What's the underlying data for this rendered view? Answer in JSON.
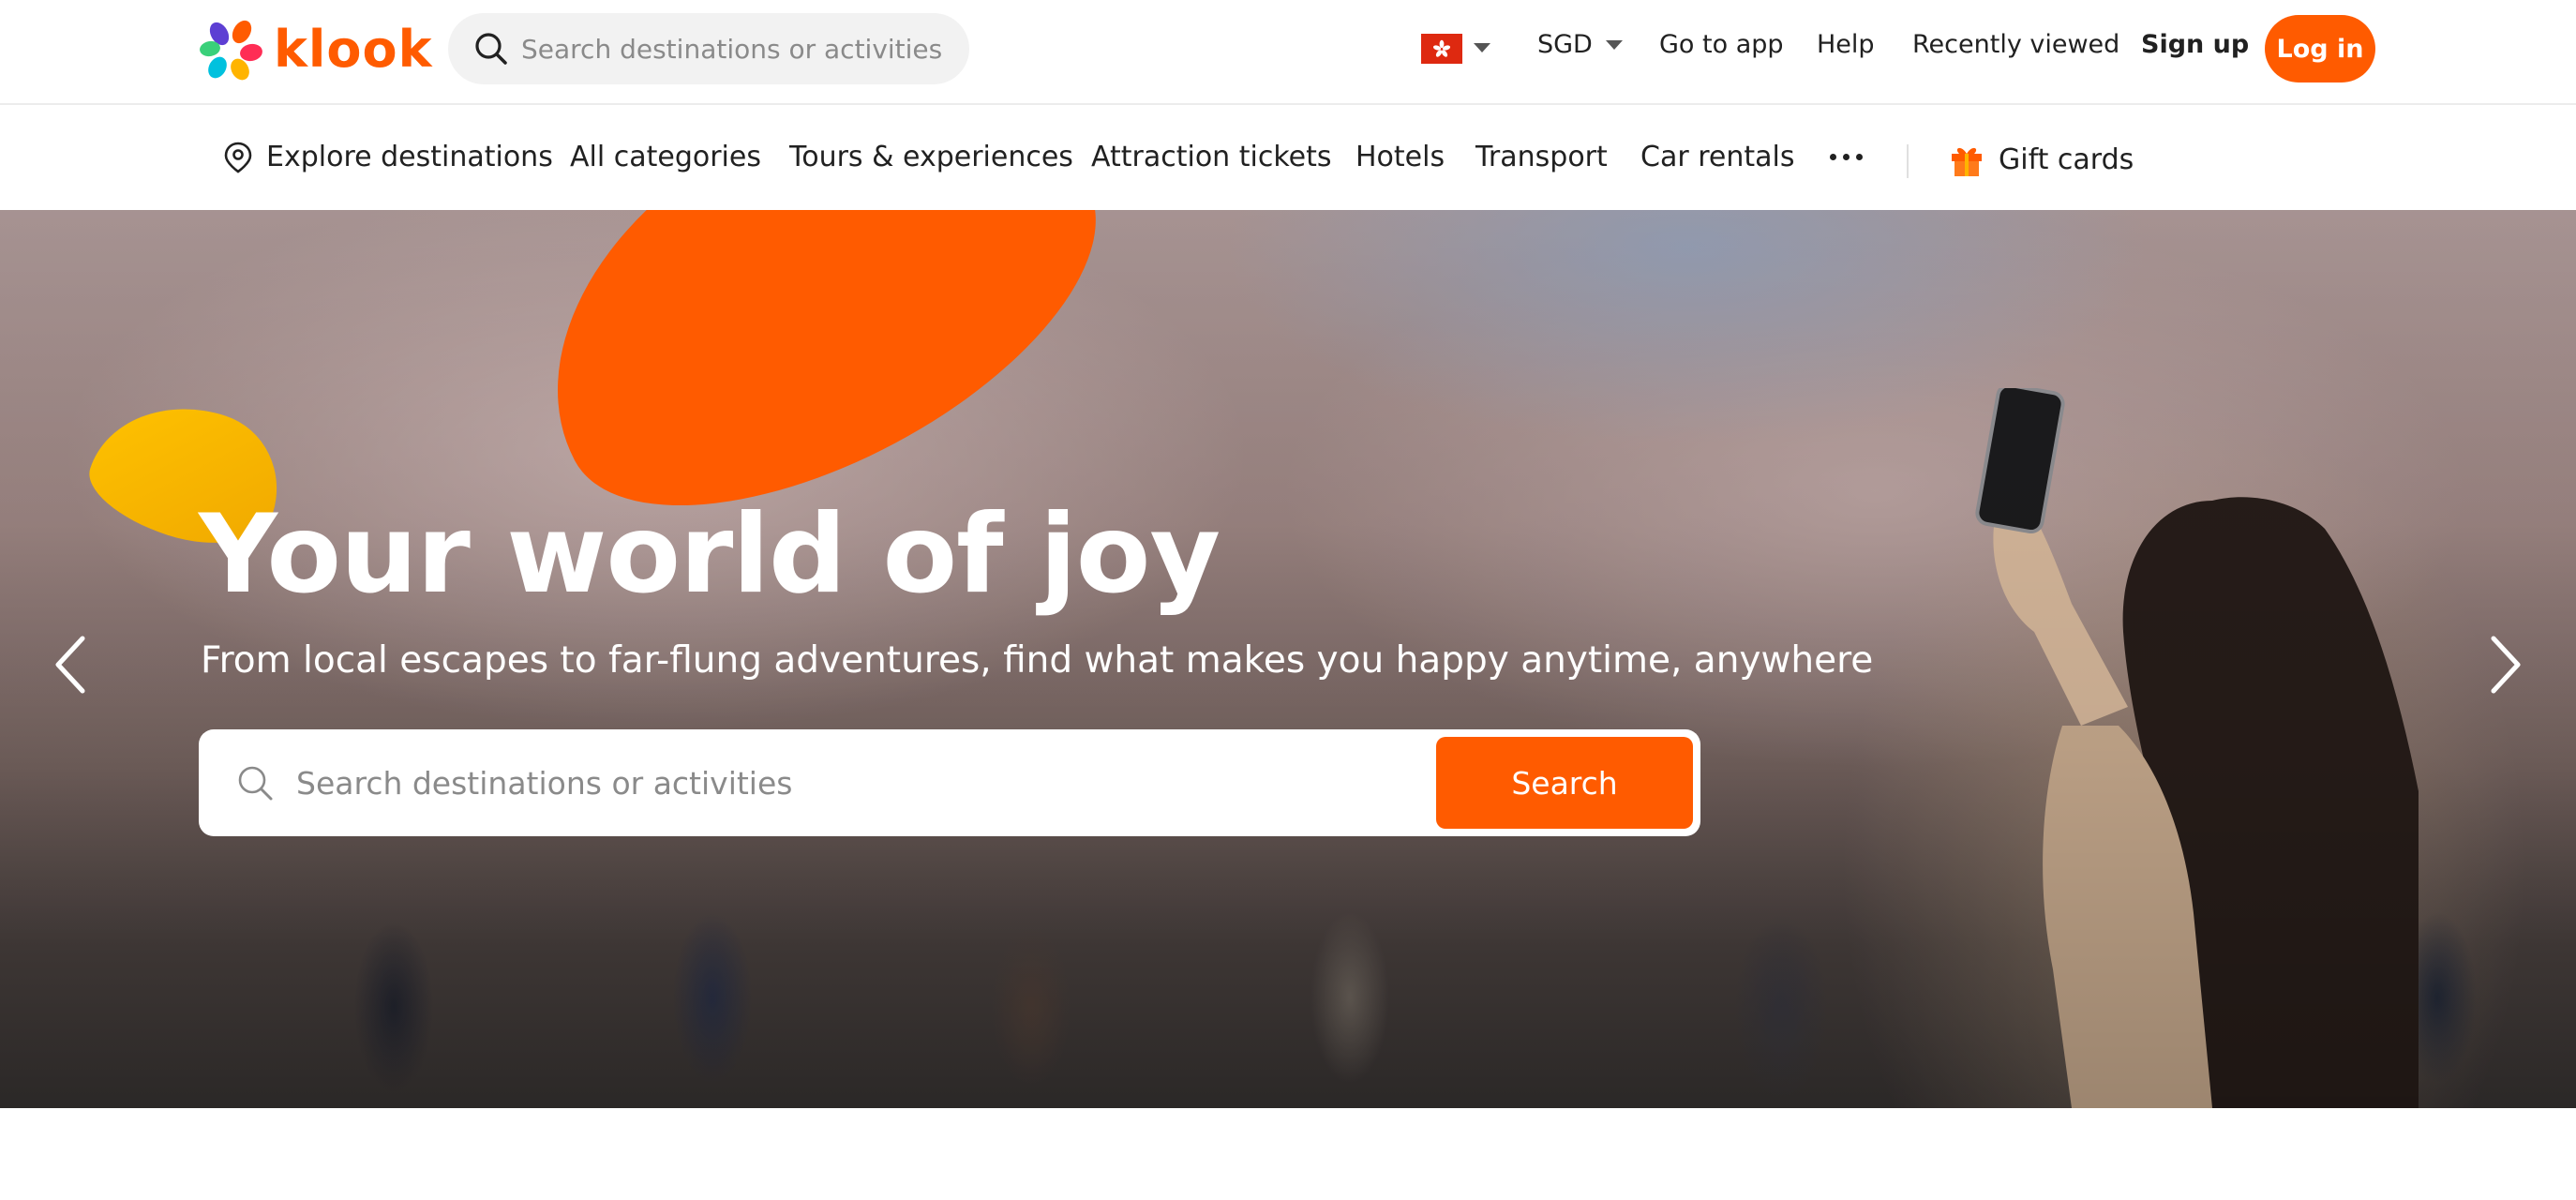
{
  "brand": {
    "name": "klook",
    "accent": "#ff5b00"
  },
  "header": {
    "search_placeholder": "Search destinations or activities",
    "region_flag": "hong-kong-flag-icon",
    "currency": "SGD",
    "links": {
      "go_to_app": "Go to app",
      "help": "Help",
      "recently_viewed": "Recently viewed",
      "sign_up": "Sign up",
      "log_in": "Log in"
    }
  },
  "categories": {
    "explore": "Explore destinations",
    "all": "All categories",
    "tours": "Tours & experiences",
    "attractions": "Attraction tickets",
    "hotels": "Hotels",
    "transport": "Transport",
    "car_rentals": "Car rentals",
    "gift_cards": "Gift cards"
  },
  "hero": {
    "title": "Your world of joy",
    "subtitle": "From local escapes to far-flung adventures, find what makes you happy anytime, anywhere",
    "search_placeholder": "Search destinations or activities",
    "search_button": "Search"
  }
}
